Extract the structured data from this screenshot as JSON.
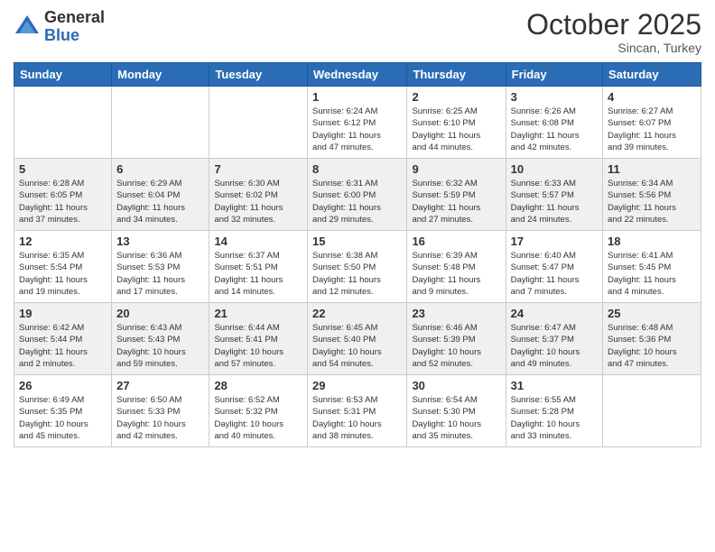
{
  "header": {
    "logo_general": "General",
    "logo_blue": "Blue",
    "month": "October 2025",
    "location": "Sincan, Turkey"
  },
  "weekdays": [
    "Sunday",
    "Monday",
    "Tuesday",
    "Wednesday",
    "Thursday",
    "Friday",
    "Saturday"
  ],
  "rows": [
    [
      {
        "num": "",
        "info": ""
      },
      {
        "num": "",
        "info": ""
      },
      {
        "num": "",
        "info": ""
      },
      {
        "num": "1",
        "info": "Sunrise: 6:24 AM\nSunset: 6:12 PM\nDaylight: 11 hours\nand 47 minutes."
      },
      {
        "num": "2",
        "info": "Sunrise: 6:25 AM\nSunset: 6:10 PM\nDaylight: 11 hours\nand 44 minutes."
      },
      {
        "num": "3",
        "info": "Sunrise: 6:26 AM\nSunset: 6:08 PM\nDaylight: 11 hours\nand 42 minutes."
      },
      {
        "num": "4",
        "info": "Sunrise: 6:27 AM\nSunset: 6:07 PM\nDaylight: 11 hours\nand 39 minutes."
      }
    ],
    [
      {
        "num": "5",
        "info": "Sunrise: 6:28 AM\nSunset: 6:05 PM\nDaylight: 11 hours\nand 37 minutes."
      },
      {
        "num": "6",
        "info": "Sunrise: 6:29 AM\nSunset: 6:04 PM\nDaylight: 11 hours\nand 34 minutes."
      },
      {
        "num": "7",
        "info": "Sunrise: 6:30 AM\nSunset: 6:02 PM\nDaylight: 11 hours\nand 32 minutes."
      },
      {
        "num": "8",
        "info": "Sunrise: 6:31 AM\nSunset: 6:00 PM\nDaylight: 11 hours\nand 29 minutes."
      },
      {
        "num": "9",
        "info": "Sunrise: 6:32 AM\nSunset: 5:59 PM\nDaylight: 11 hours\nand 27 minutes."
      },
      {
        "num": "10",
        "info": "Sunrise: 6:33 AM\nSunset: 5:57 PM\nDaylight: 11 hours\nand 24 minutes."
      },
      {
        "num": "11",
        "info": "Sunrise: 6:34 AM\nSunset: 5:56 PM\nDaylight: 11 hours\nand 22 minutes."
      }
    ],
    [
      {
        "num": "12",
        "info": "Sunrise: 6:35 AM\nSunset: 5:54 PM\nDaylight: 11 hours\nand 19 minutes."
      },
      {
        "num": "13",
        "info": "Sunrise: 6:36 AM\nSunset: 5:53 PM\nDaylight: 11 hours\nand 17 minutes."
      },
      {
        "num": "14",
        "info": "Sunrise: 6:37 AM\nSunset: 5:51 PM\nDaylight: 11 hours\nand 14 minutes."
      },
      {
        "num": "15",
        "info": "Sunrise: 6:38 AM\nSunset: 5:50 PM\nDaylight: 11 hours\nand 12 minutes."
      },
      {
        "num": "16",
        "info": "Sunrise: 6:39 AM\nSunset: 5:48 PM\nDaylight: 11 hours\nand 9 minutes."
      },
      {
        "num": "17",
        "info": "Sunrise: 6:40 AM\nSunset: 5:47 PM\nDaylight: 11 hours\nand 7 minutes."
      },
      {
        "num": "18",
        "info": "Sunrise: 6:41 AM\nSunset: 5:45 PM\nDaylight: 11 hours\nand 4 minutes."
      }
    ],
    [
      {
        "num": "19",
        "info": "Sunrise: 6:42 AM\nSunset: 5:44 PM\nDaylight: 11 hours\nand 2 minutes."
      },
      {
        "num": "20",
        "info": "Sunrise: 6:43 AM\nSunset: 5:43 PM\nDaylight: 10 hours\nand 59 minutes."
      },
      {
        "num": "21",
        "info": "Sunrise: 6:44 AM\nSunset: 5:41 PM\nDaylight: 10 hours\nand 57 minutes."
      },
      {
        "num": "22",
        "info": "Sunrise: 6:45 AM\nSunset: 5:40 PM\nDaylight: 10 hours\nand 54 minutes."
      },
      {
        "num": "23",
        "info": "Sunrise: 6:46 AM\nSunset: 5:39 PM\nDaylight: 10 hours\nand 52 minutes."
      },
      {
        "num": "24",
        "info": "Sunrise: 6:47 AM\nSunset: 5:37 PM\nDaylight: 10 hours\nand 49 minutes."
      },
      {
        "num": "25",
        "info": "Sunrise: 6:48 AM\nSunset: 5:36 PM\nDaylight: 10 hours\nand 47 minutes."
      }
    ],
    [
      {
        "num": "26",
        "info": "Sunrise: 6:49 AM\nSunset: 5:35 PM\nDaylight: 10 hours\nand 45 minutes."
      },
      {
        "num": "27",
        "info": "Sunrise: 6:50 AM\nSunset: 5:33 PM\nDaylight: 10 hours\nand 42 minutes."
      },
      {
        "num": "28",
        "info": "Sunrise: 6:52 AM\nSunset: 5:32 PM\nDaylight: 10 hours\nand 40 minutes."
      },
      {
        "num": "29",
        "info": "Sunrise: 6:53 AM\nSunset: 5:31 PM\nDaylight: 10 hours\nand 38 minutes."
      },
      {
        "num": "30",
        "info": "Sunrise: 6:54 AM\nSunset: 5:30 PM\nDaylight: 10 hours\nand 35 minutes."
      },
      {
        "num": "31",
        "info": "Sunrise: 6:55 AM\nSunset: 5:28 PM\nDaylight: 10 hours\nand 33 minutes."
      },
      {
        "num": "",
        "info": ""
      }
    ]
  ]
}
